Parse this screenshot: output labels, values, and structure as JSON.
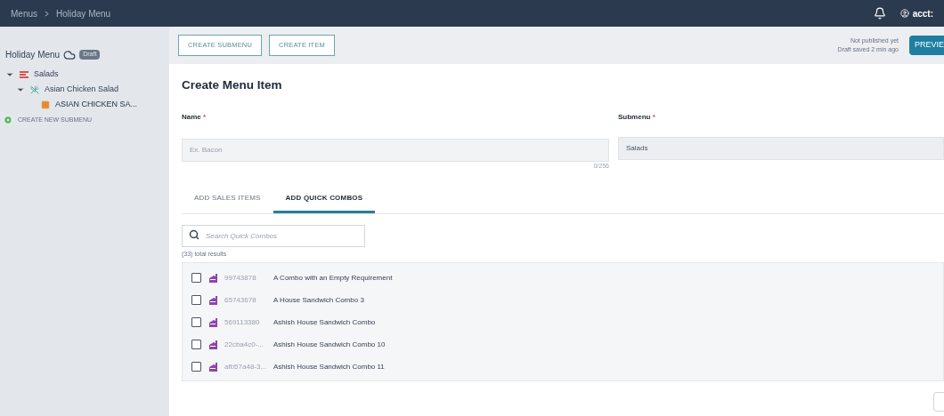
{
  "breadcrumb": [
    {
      "label": "Menus"
    },
    {
      "label": "Holiday Menu"
    }
  ],
  "account": {
    "label": "acct:"
  },
  "sidebar": {
    "menu_title": "Holiday Menu",
    "status_badge": "Draft",
    "tree": [
      {
        "label": "Salads",
        "kind": "submenu",
        "expanded": true,
        "children": [
          {
            "label": "Asian Chicken Salad",
            "kind": "item",
            "expanded": true,
            "children": [
              {
                "label": "ASIAN CHICKEN SA...",
                "kind": "sales_item"
              }
            ]
          }
        ]
      }
    ],
    "create_link": "CREATE NEW SUBMENU"
  },
  "toolbar": {
    "buttons": [
      "CREATE SUBMENU",
      "CREATE ITEM"
    ],
    "status_lines": [
      "Not published yet",
      "Draft saved 2 min ago"
    ],
    "preview_button": "PREVIE"
  },
  "form": {
    "title": "Create Menu Item",
    "name_label": "Name",
    "name_placeholder": "Ex. Bacon",
    "name_counter": "0/256",
    "required_mark": "*",
    "submenu_label": "Submenu",
    "submenu_value": "Salads",
    "tabs": [
      {
        "label": "ADD SALES ITEMS",
        "selected": false
      },
      {
        "label": "ADD QUICK COMBOS",
        "selected": true
      }
    ],
    "search_placeholder": "Search Quick Combos",
    "results_count": "(33) total results",
    "combos": [
      {
        "code": "99743878",
        "name": "A Combo with an Empty Requirement",
        "checked": false
      },
      {
        "code": "65743678",
        "name": "A House Sandwich Combo 3",
        "checked": false
      },
      {
        "code": "569113380",
        "name": "Ashish House Sandwich Combo",
        "checked": false
      },
      {
        "code": "22cba4c0-...",
        "name": "Ashish House Sandwich Combo 10",
        "checked": false
      },
      {
        "code": "afb57a48-3...",
        "name": "Ashish House Sandwich Combo 11",
        "checked": false
      }
    ]
  }
}
